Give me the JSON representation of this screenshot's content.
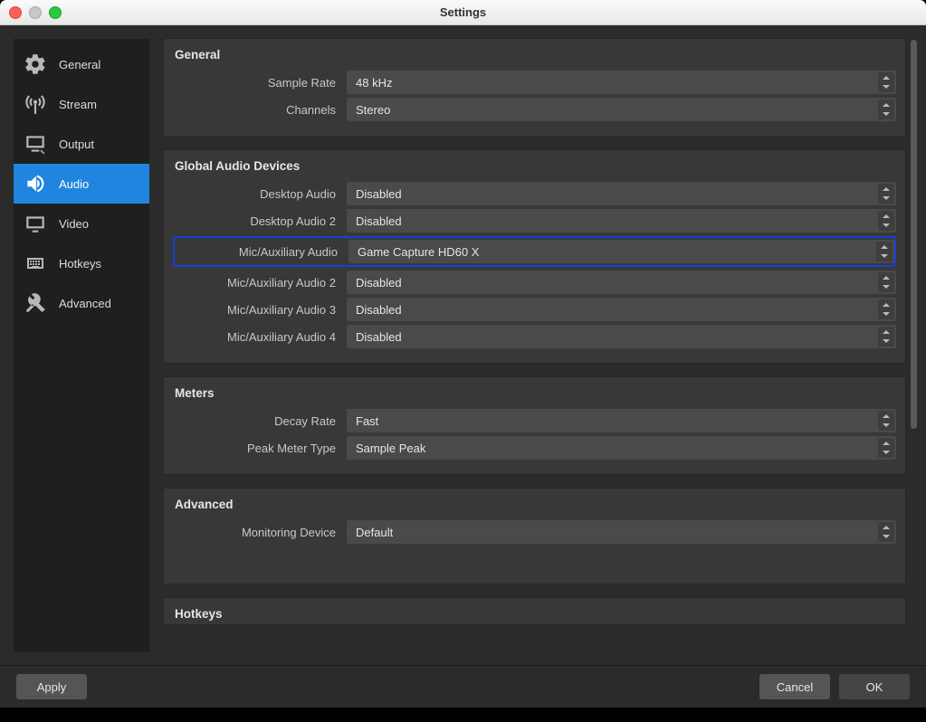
{
  "window": {
    "title": "Settings"
  },
  "sidebar": {
    "items": [
      {
        "label": "General"
      },
      {
        "label": "Stream"
      },
      {
        "label": "Output"
      },
      {
        "label": "Audio"
      },
      {
        "label": "Video"
      },
      {
        "label": "Hotkeys"
      },
      {
        "label": "Advanced"
      }
    ],
    "active_index": 3
  },
  "sections": {
    "general": {
      "title": "General",
      "sample_rate": {
        "label": "Sample Rate",
        "value": "48 kHz"
      },
      "channels": {
        "label": "Channels",
        "value": "Stereo"
      }
    },
    "global_audio": {
      "title": "Global Audio Devices",
      "desktop_audio": {
        "label": "Desktop Audio",
        "value": "Disabled"
      },
      "desktop_audio_2": {
        "label": "Desktop Audio 2",
        "value": "Disabled"
      },
      "mic_aux": {
        "label": "Mic/Auxiliary Audio",
        "value": "Game Capture HD60 X"
      },
      "mic_aux_2": {
        "label": "Mic/Auxiliary Audio 2",
        "value": "Disabled"
      },
      "mic_aux_3": {
        "label": "Mic/Auxiliary Audio 3",
        "value": "Disabled"
      },
      "mic_aux_4": {
        "label": "Mic/Auxiliary Audio 4",
        "value": "Disabled"
      }
    },
    "meters": {
      "title": "Meters",
      "decay_rate": {
        "label": "Decay Rate",
        "value": "Fast"
      },
      "peak_meter_type": {
        "label": "Peak Meter Type",
        "value": "Sample Peak"
      }
    },
    "advanced": {
      "title": "Advanced",
      "monitoring_device": {
        "label": "Monitoring Device",
        "value": "Default"
      }
    },
    "hotkeys": {
      "title": "Hotkeys"
    }
  },
  "footer": {
    "apply": "Apply",
    "cancel": "Cancel",
    "ok": "OK"
  }
}
